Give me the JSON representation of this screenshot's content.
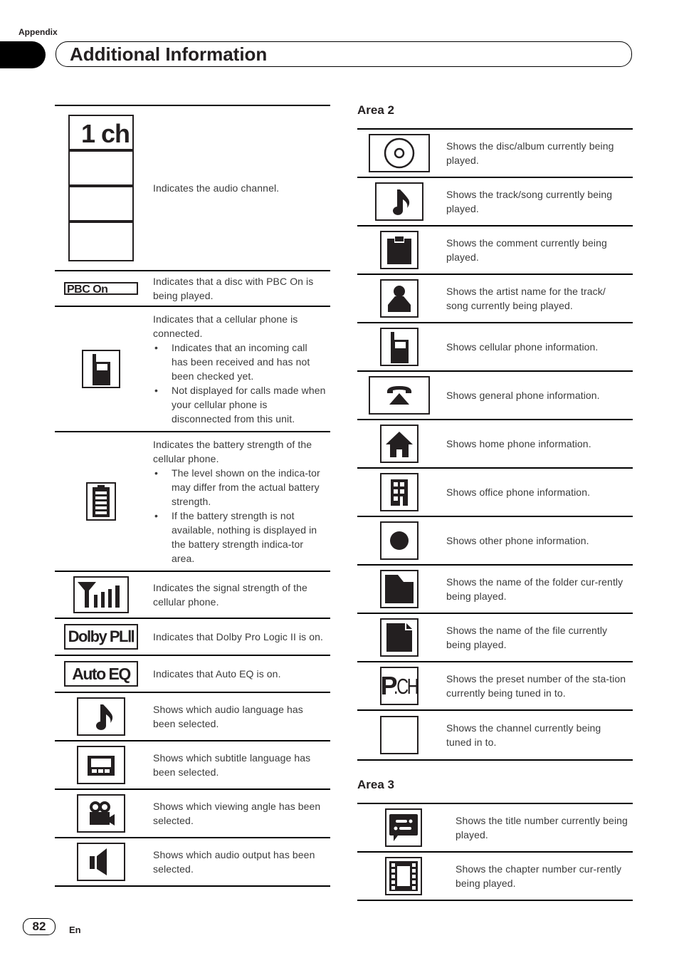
{
  "header": {
    "section": "Appendix",
    "title": "Additional Information"
  },
  "left_table": {
    "rows": [
      {
        "icon": "audio-channel-indicator-icon",
        "icon_text": "1 ch",
        "text": "Indicates the audio channel."
      },
      {
        "icon": "pbc-on-indicator-icon",
        "icon_text": "PBC On",
        "text": "Indicates that a disc with PBC On is being played."
      },
      {
        "icon": "cellular-phone-icon",
        "text": "Indicates that a cellular phone is connected.",
        "bullets": [
          "Indicates that an incoming call has been received and has not been checked yet.",
          "Not displayed for calls made when your cellular phone is disconnected from this unit."
        ]
      },
      {
        "icon": "battery-icon",
        "text": "Indicates the battery strength of the cellular phone.",
        "bullets": [
          "The level shown on the indica-tor may differ from the actual battery strength.",
          "If the battery strength is not available, nothing is displayed in the battery strength indica-tor area."
        ]
      },
      {
        "icon": "signal-strength-icon",
        "text": "Indicates the signal strength of the cellular phone."
      },
      {
        "icon": "dolby-pl2-icon",
        "icon_text": "Dolby PLⅡ",
        "text": "Indicates that Dolby Pro Logic II is on."
      },
      {
        "icon": "auto-eq-icon",
        "icon_text": "Auto EQ",
        "text": "Indicates that Auto EQ is on."
      },
      {
        "icon": "music-note-icon",
        "text": "Shows which audio language has been selected."
      },
      {
        "icon": "subtitle-icon",
        "text": "Shows which subtitle language has been selected."
      },
      {
        "icon": "camera-angle-icon",
        "text": "Shows which viewing angle has been selected."
      },
      {
        "icon": "speaker-icon",
        "text": "Shows which audio output has been selected."
      }
    ]
  },
  "area2": {
    "heading": "Area 2",
    "rows": [
      {
        "icon": "disc-icon",
        "text": "Shows the disc/album currently being played."
      },
      {
        "icon": "music-note-icon",
        "text": "Shows the track/song currently being played."
      },
      {
        "icon": "comment-icon",
        "text": "Shows the comment currently being played."
      },
      {
        "icon": "artist-icon",
        "text": "Shows the artist name for  the track/ song currently being played."
      },
      {
        "icon": "cellular-phone-icon",
        "text": "Shows cellular phone information."
      },
      {
        "icon": "general-phone-icon",
        "text": "Shows general phone information."
      },
      {
        "icon": "home-icon",
        "text": "Shows home phone information."
      },
      {
        "icon": "office-icon",
        "text": "Shows office phone information."
      },
      {
        "icon": "other-phone-icon",
        "text": "Shows other phone information."
      },
      {
        "icon": "folder-icon",
        "text": "Shows the name of the folder cur-rently being played."
      },
      {
        "icon": "file-icon",
        "text": "Shows the name of the file currently being played."
      },
      {
        "icon": "preset-channel-icon",
        "icon_text_bold": "P",
        "icon_text_rest": ".CH",
        "text": "Shows the preset number of the sta-tion currently being tuned in to."
      },
      {
        "icon": "channel-icon",
        "text": "Shows the channel currently being tuned in to."
      }
    ]
  },
  "area3": {
    "heading": "Area 3",
    "rows": [
      {
        "icon": "title-icon",
        "text": "Shows the title number currently being played."
      },
      {
        "icon": "chapter-icon",
        "text": "Shows the chapter number cur-rently being played."
      }
    ]
  },
  "footer": {
    "page_number": "82",
    "language": "En"
  }
}
